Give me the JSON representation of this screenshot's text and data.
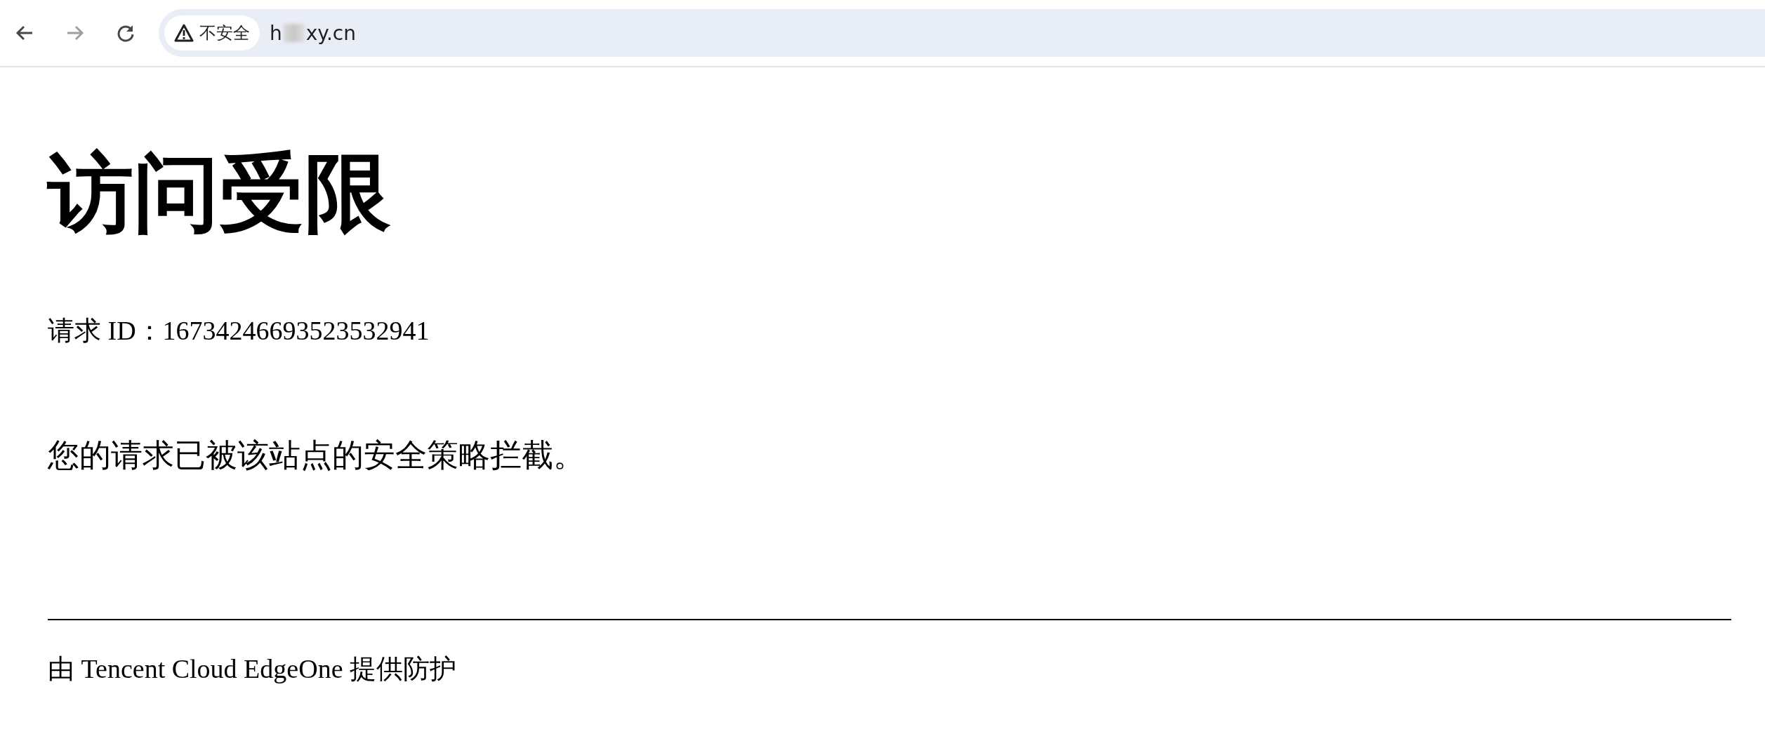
{
  "toolbar": {
    "back": {
      "disabled": false
    },
    "forward": {
      "disabled": true
    },
    "security_chip": {
      "label": "不安全"
    },
    "address": {
      "start": "h",
      "end": "xy.cn"
    }
  },
  "page": {
    "title": "访问受限",
    "request_id_label": "请求 ID：",
    "request_id": "16734246693523532941",
    "message": "您的请求已被该站点的安全策略拦截。",
    "footer": "由 Tencent Cloud EdgeOne 提供防护"
  }
}
